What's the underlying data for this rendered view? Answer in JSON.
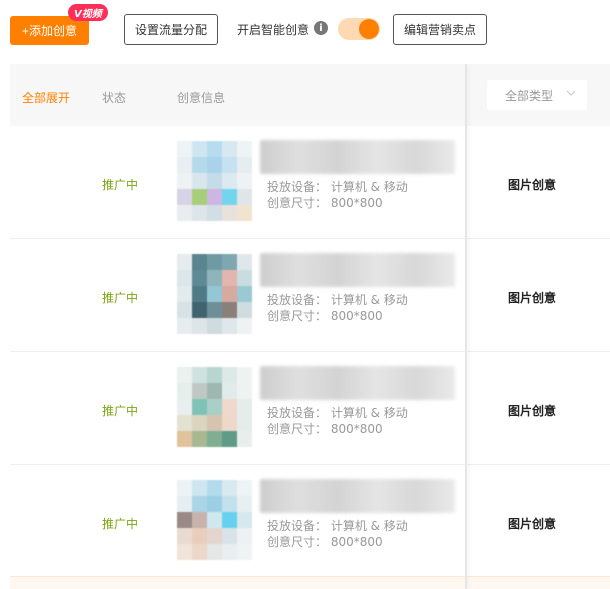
{
  "toolbar": {
    "add_label": "+添加创意",
    "badge": "V视频",
    "flow_label": "设置流量分配",
    "smart_label": "开启智能创意",
    "smart_on": true,
    "edit_label": "编辑营销卖点",
    "accent": "#ff8000"
  },
  "table": {
    "expand_label": "全部展开",
    "status_header": "状态",
    "info_header": "创意信息",
    "type_select": "全部类型",
    "rows": [
      {
        "status": "推广中",
        "device": "投放设备： 计算机 & 移动",
        "size": "创意尺寸： 800*800",
        "type": "图片创意"
      },
      {
        "status": "推广中",
        "device": "投放设备： 计算机 & 移动",
        "size": "创意尺寸： 800*800",
        "type": "图片创意"
      },
      {
        "status": "推广中",
        "device": "投放设备： 计算机 & 移动",
        "size": "创意尺寸： 800*800",
        "type": "图片创意"
      },
      {
        "status": "推广中",
        "device": "投放设备： 计算机 & 移动",
        "size": "创意尺寸： 800*800",
        "type": "图片创意"
      }
    ]
  }
}
